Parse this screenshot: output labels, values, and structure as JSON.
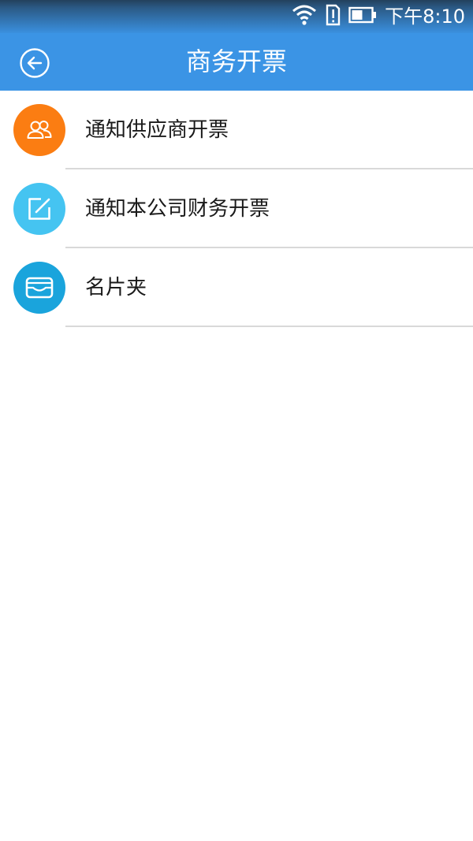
{
  "status_bar": {
    "time": "下午8:10",
    "icons": [
      "wifi-icon",
      "alert-sim-icon",
      "battery-icon"
    ]
  },
  "header": {
    "title": "商务开票",
    "back_icon": "back-arrow-icon"
  },
  "menu": {
    "items": [
      {
        "label": "通知供应商开票",
        "icon": "people-icon",
        "color": "#fb7d12"
      },
      {
        "label": "通知本公司财务开票",
        "icon": "edit-icon",
        "color": "#45c4f1"
      },
      {
        "label": "名片夹",
        "icon": "card-holder-icon",
        "color": "#1aa4dc"
      }
    ]
  },
  "colors": {
    "app_bar": "#3b94e5",
    "divider": "#d9d9d9"
  }
}
